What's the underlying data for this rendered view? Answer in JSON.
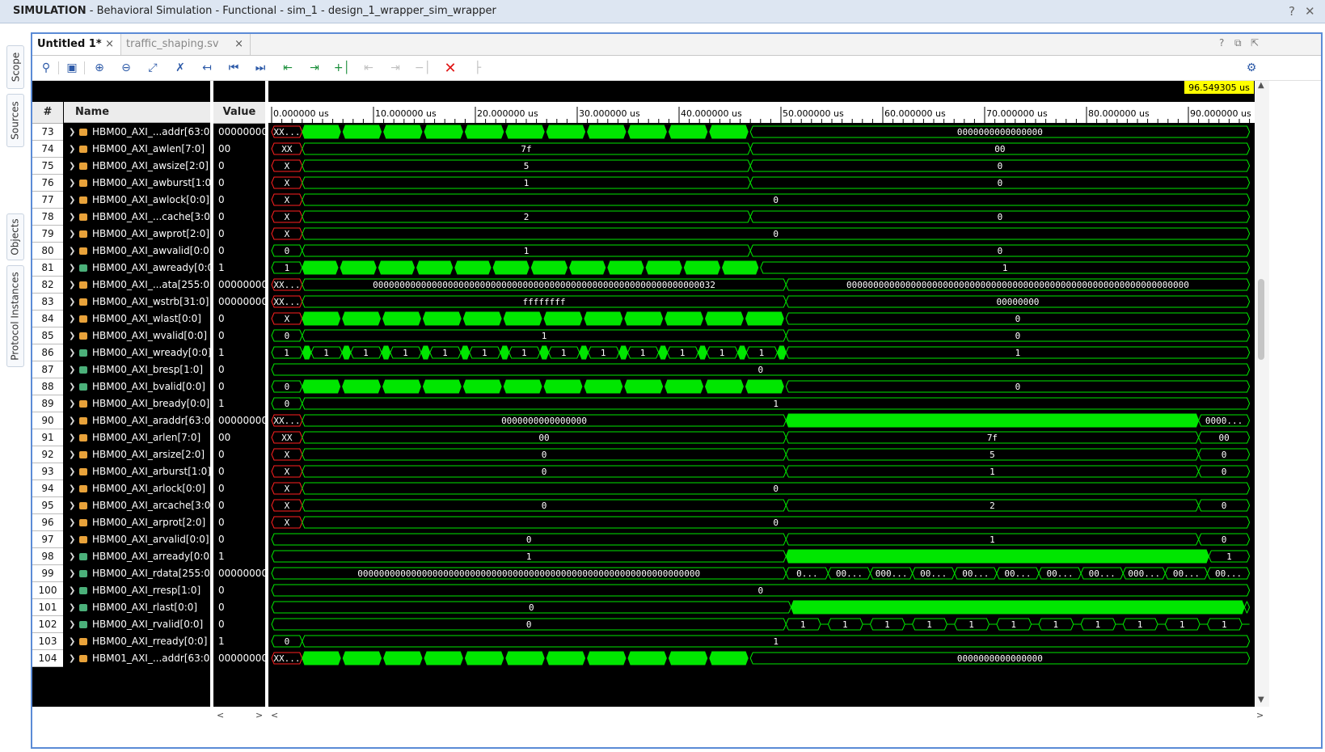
{
  "window": {
    "title_bold": "SIMULATION",
    "title_rest": " - Behavioral Simulation - Functional - sim_1 - design_1_wrapper_sim_wrapper",
    "help": "?",
    "close": "✕"
  },
  "side_tabs": [
    "Scope",
    "Sources",
    "Objects",
    "Protocol Instances"
  ],
  "tabs": [
    {
      "label": "Untitled 1*",
      "active": true
    },
    {
      "label": "traffic_shaping.sv",
      "active": false
    }
  ],
  "tab_icons": {
    "help": "?",
    "restore": "⧉",
    "popout": "⇱"
  },
  "toolbar": {
    "icons": [
      "search-icon",
      "save-icon",
      "zoom-in-icon",
      "zoom-out-icon",
      "zoom-fit-icon",
      "swap-cursor-icon",
      "go-to-cursor-icon",
      "go-to-start-icon",
      "go-to-end-icon",
      "previous-transition-icon",
      "next-transition-icon",
      "add-marker-icon",
      "previous-marker-icon",
      "next-marker-icon",
      "swap-markers-icon",
      "delete-icon",
      "snap-icon",
      "settings-icon"
    ]
  },
  "columns": {
    "num": "#",
    "name": "Name",
    "value": "Value"
  },
  "cursor_time": "96.549305 us",
  "time_ticks": [
    "0.000000 us",
    "10.000000 us",
    "20.000000 us",
    "30.000000 us",
    "40.000000 us",
    "50.000000 us",
    "60.000000 us",
    "70.000000 us",
    "80.000000 us",
    "90.000000 us"
  ],
  "signals": [
    {
      "num": "73",
      "name": "HBM00_AXI_...addr[63:0]",
      "value": "00000000",
      "icon": "bus"
    },
    {
      "num": "74",
      "name": "HBM00_AXI_awlen[7:0]",
      "value": "00",
      "icon": "bus"
    },
    {
      "num": "75",
      "name": "HBM00_AXI_awsize[2:0]",
      "value": "0",
      "icon": "bus"
    },
    {
      "num": "76",
      "name": "HBM00_AXI_awburst[1:0]",
      "value": "0",
      "icon": "bus"
    },
    {
      "num": "77",
      "name": "HBM00_AXI_awlock[0:0]",
      "value": "0",
      "icon": "bus"
    },
    {
      "num": "78",
      "name": "HBM00_AXI_...cache[3:0]",
      "value": "0",
      "icon": "bus"
    },
    {
      "num": "79",
      "name": "HBM00_AXI_awprot[2:0]",
      "value": "0",
      "icon": "bus"
    },
    {
      "num": "80",
      "name": "HBM00_AXI_awvalid[0:0]",
      "value": "0",
      "icon": "bus"
    },
    {
      "num": "81",
      "name": "HBM00_AXI_awready[0:0]",
      "value": "1",
      "icon": "in"
    },
    {
      "num": "82",
      "name": "HBM00_AXI_...ata[255:0]",
      "value": "00000000",
      "icon": "bus"
    },
    {
      "num": "83",
      "name": "HBM00_AXI_wstrb[31:0]",
      "value": "00000000",
      "icon": "bus"
    },
    {
      "num": "84",
      "name": "HBM00_AXI_wlast[0:0]",
      "value": "0",
      "icon": "bus"
    },
    {
      "num": "85",
      "name": "HBM00_AXI_wvalid[0:0]",
      "value": "0",
      "icon": "bus"
    },
    {
      "num": "86",
      "name": "HBM00_AXI_wready[0:0]",
      "value": "1",
      "icon": "in"
    },
    {
      "num": "87",
      "name": "HBM00_AXI_bresp[1:0]",
      "value": "0",
      "icon": "in"
    },
    {
      "num": "88",
      "name": "HBM00_AXI_bvalid[0:0]",
      "value": "0",
      "icon": "in"
    },
    {
      "num": "89",
      "name": "HBM00_AXI_bready[0:0]",
      "value": "1",
      "icon": "bus"
    },
    {
      "num": "90",
      "name": "HBM00_AXI_araddr[63:0]",
      "value": "00000000",
      "icon": "bus"
    },
    {
      "num": "91",
      "name": "HBM00_AXI_arlen[7:0]",
      "value": "00",
      "icon": "bus"
    },
    {
      "num": "92",
      "name": "HBM00_AXI_arsize[2:0]",
      "value": "0",
      "icon": "bus"
    },
    {
      "num": "93",
      "name": "HBM00_AXI_arburst[1:0]",
      "value": "0",
      "icon": "bus"
    },
    {
      "num": "94",
      "name": "HBM00_AXI_arlock[0:0]",
      "value": "0",
      "icon": "bus"
    },
    {
      "num": "95",
      "name": "HBM00_AXI_arcache[3:0]",
      "value": "0",
      "icon": "bus"
    },
    {
      "num": "96",
      "name": "HBM00_AXI_arprot[2:0]",
      "value": "0",
      "icon": "bus"
    },
    {
      "num": "97",
      "name": "HBM00_AXI_arvalid[0:0]",
      "value": "0",
      "icon": "bus"
    },
    {
      "num": "98",
      "name": "HBM00_AXI_arready[0:0]",
      "value": "1",
      "icon": "in"
    },
    {
      "num": "99",
      "name": "HBM00_AXI_rdata[255:0]",
      "value": "00000000",
      "icon": "in"
    },
    {
      "num": "100",
      "name": "HBM00_AXI_rresp[1:0]",
      "value": "0",
      "icon": "in"
    },
    {
      "num": "101",
      "name": "HBM00_AXI_rlast[0:0]",
      "value": "0",
      "icon": "in"
    },
    {
      "num": "102",
      "name": "HBM00_AXI_rvalid[0:0]",
      "value": "0",
      "icon": "in"
    },
    {
      "num": "103",
      "name": "HBM00_AXI_rready[0:0]",
      "value": "1",
      "icon": "bus"
    },
    {
      "num": "104",
      "name": "HBM01_AXI_...addr[63:0]",
      "value": "00000000",
      "icon": "bus"
    }
  ],
  "waveforms": [
    {
      "segs": [
        [
          0,
          3,
          "XX...",
          "x"
        ],
        [
          3,
          47,
          "",
          "burst"
        ],
        [
          47,
          96,
          "0000000000000000",
          "v"
        ]
      ]
    },
    {
      "segs": [
        [
          0,
          3,
          "XX",
          "x"
        ],
        [
          3,
          47,
          "7f",
          "v"
        ],
        [
          47,
          96,
          "00",
          "v"
        ]
      ]
    },
    {
      "segs": [
        [
          0,
          3,
          "X",
          "x"
        ],
        [
          3,
          47,
          "5",
          "v"
        ],
        [
          47,
          96,
          "0",
          "v"
        ]
      ]
    },
    {
      "segs": [
        [
          0,
          3,
          "X",
          "x"
        ],
        [
          3,
          47,
          "1",
          "v"
        ],
        [
          47,
          96,
          "0",
          "v"
        ]
      ]
    },
    {
      "segs": [
        [
          0,
          3,
          "X",
          "x"
        ],
        [
          3,
          96,
          "0",
          "v"
        ]
      ]
    },
    {
      "segs": [
        [
          0,
          3,
          "X",
          "x"
        ],
        [
          3,
          47,
          "2",
          "v"
        ],
        [
          47,
          96,
          "0",
          "v"
        ]
      ]
    },
    {
      "segs": [
        [
          0,
          3,
          "X",
          "x"
        ],
        [
          3,
          96,
          "0",
          "v"
        ]
      ]
    },
    {
      "segs": [
        [
          0,
          3,
          "0",
          "v"
        ],
        [
          3,
          47,
          "1",
          "v"
        ],
        [
          47,
          96,
          "0",
          "v"
        ]
      ]
    },
    {
      "segs": [
        [
          0,
          3,
          "1",
          "v"
        ],
        [
          3,
          48,
          "",
          "burst"
        ],
        [
          48,
          96,
          "1",
          "v"
        ]
      ]
    },
    {
      "segs": [
        [
          0,
          3,
          "XX...",
          "x"
        ],
        [
          3,
          50.5,
          "0000000000000000000000000000000000000000000000000000000000000032",
          "v"
        ],
        [
          50.5,
          96,
          "0000000000000000000000000000000000000000000000000000000000000000",
          "v"
        ]
      ]
    },
    {
      "segs": [
        [
          0,
          3,
          "XX...",
          "x"
        ],
        [
          3,
          50.5,
          "ffffffff",
          "v"
        ],
        [
          50.5,
          96,
          "00000000",
          "v"
        ]
      ]
    },
    {
      "segs": [
        [
          0,
          3,
          "X",
          "x"
        ],
        [
          3,
          50.5,
          "",
          "burst"
        ],
        [
          50.5,
          96,
          "0",
          "v"
        ]
      ]
    },
    {
      "segs": [
        [
          0,
          3,
          "0",
          "v"
        ],
        [
          3,
          50.5,
          "1",
          "v"
        ],
        [
          50.5,
          96,
          "0",
          "v"
        ]
      ]
    },
    {
      "segs": [
        [
          0,
          50.5,
          "1",
          "toggle"
        ],
        [
          50.5,
          96,
          "1",
          "v"
        ]
      ]
    },
    {
      "segs": [
        [
          0,
          96,
          "0",
          "v"
        ]
      ]
    },
    {
      "segs": [
        [
          0,
          3,
          "0",
          "v"
        ],
        [
          3,
          50.5,
          "",
          "burst"
        ],
        [
          50.5,
          96,
          "0",
          "v"
        ]
      ]
    },
    {
      "segs": [
        [
          0,
          3,
          "0",
          "v"
        ],
        [
          3,
          96,
          "1",
          "v"
        ]
      ]
    },
    {
      "segs": [
        [
          0,
          3,
          "XX...",
          "x"
        ],
        [
          3,
          50.5,
          "0000000000000000",
          "v"
        ],
        [
          50.5,
          91,
          "",
          "solid"
        ],
        [
          91,
          96,
          "0000...",
          "v"
        ]
      ]
    },
    {
      "segs": [
        [
          0,
          3,
          "XX",
          "x"
        ],
        [
          3,
          50.5,
          "00",
          "v"
        ],
        [
          50.5,
          91,
          "7f",
          "v"
        ],
        [
          91,
          96,
          "00",
          "v"
        ]
      ]
    },
    {
      "segs": [
        [
          0,
          3,
          "X",
          "x"
        ],
        [
          3,
          50.5,
          "0",
          "v"
        ],
        [
          50.5,
          91,
          "5",
          "v"
        ],
        [
          91,
          96,
          "0",
          "v"
        ]
      ]
    },
    {
      "segs": [
        [
          0,
          3,
          "X",
          "x"
        ],
        [
          3,
          50.5,
          "0",
          "v"
        ],
        [
          50.5,
          91,
          "1",
          "v"
        ],
        [
          91,
          96,
          "0",
          "v"
        ]
      ]
    },
    {
      "segs": [
        [
          0,
          3,
          "X",
          "x"
        ],
        [
          3,
          96,
          "0",
          "v"
        ]
      ]
    },
    {
      "segs": [
        [
          0,
          3,
          "X",
          "x"
        ],
        [
          3,
          50.5,
          "0",
          "v"
        ],
        [
          50.5,
          91,
          "2",
          "v"
        ],
        [
          91,
          96,
          "0",
          "v"
        ]
      ]
    },
    {
      "segs": [
        [
          0,
          3,
          "X",
          "x"
        ],
        [
          3,
          96,
          "0",
          "v"
        ]
      ]
    },
    {
      "segs": [
        [
          0,
          50.5,
          "0",
          "v"
        ],
        [
          50.5,
          91,
          "1",
          "v"
        ],
        [
          91,
          96,
          "0",
          "v"
        ]
      ]
    },
    {
      "segs": [
        [
          0,
          50.5,
          "1",
          "v"
        ],
        [
          50.5,
          92,
          "",
          "solid"
        ],
        [
          92,
          96,
          "1",
          "v"
        ]
      ]
    },
    {
      "segs": [
        [
          0,
          50.5,
          "0000000000000000000000000000000000000000000000000000000000000000",
          "v"
        ],
        [
          50.5,
          96,
          "0...",
          "rdata"
        ]
      ]
    },
    {
      "segs": [
        [
          0,
          96,
          "0",
          "v"
        ]
      ]
    },
    {
      "segs": [
        [
          0,
          51,
          "0",
          "v"
        ],
        [
          51,
          95.5,
          "",
          "solid"
        ],
        [
          95.5,
          96,
          "",
          "v"
        ]
      ]
    },
    {
      "segs": [
        [
          0,
          50.5,
          "0",
          "v"
        ],
        [
          50.5,
          96,
          "1",
          "rtoggle"
        ]
      ]
    },
    {
      "segs": [
        [
          0,
          3,
          "0",
          "v"
        ],
        [
          3,
          96,
          "1",
          "v"
        ]
      ]
    },
    {
      "segs": [
        [
          0,
          3,
          "XX...",
          "x"
        ],
        [
          3,
          47,
          "",
          "burst"
        ],
        [
          47,
          96,
          "0000000000000000",
          "v"
        ]
      ]
    }
  ],
  "colors": {
    "green": "#00e600",
    "wave_line": "#00e600",
    "x_red": "#ff2020",
    "cursor_bg": "#ffff00",
    "background": "#000000"
  }
}
